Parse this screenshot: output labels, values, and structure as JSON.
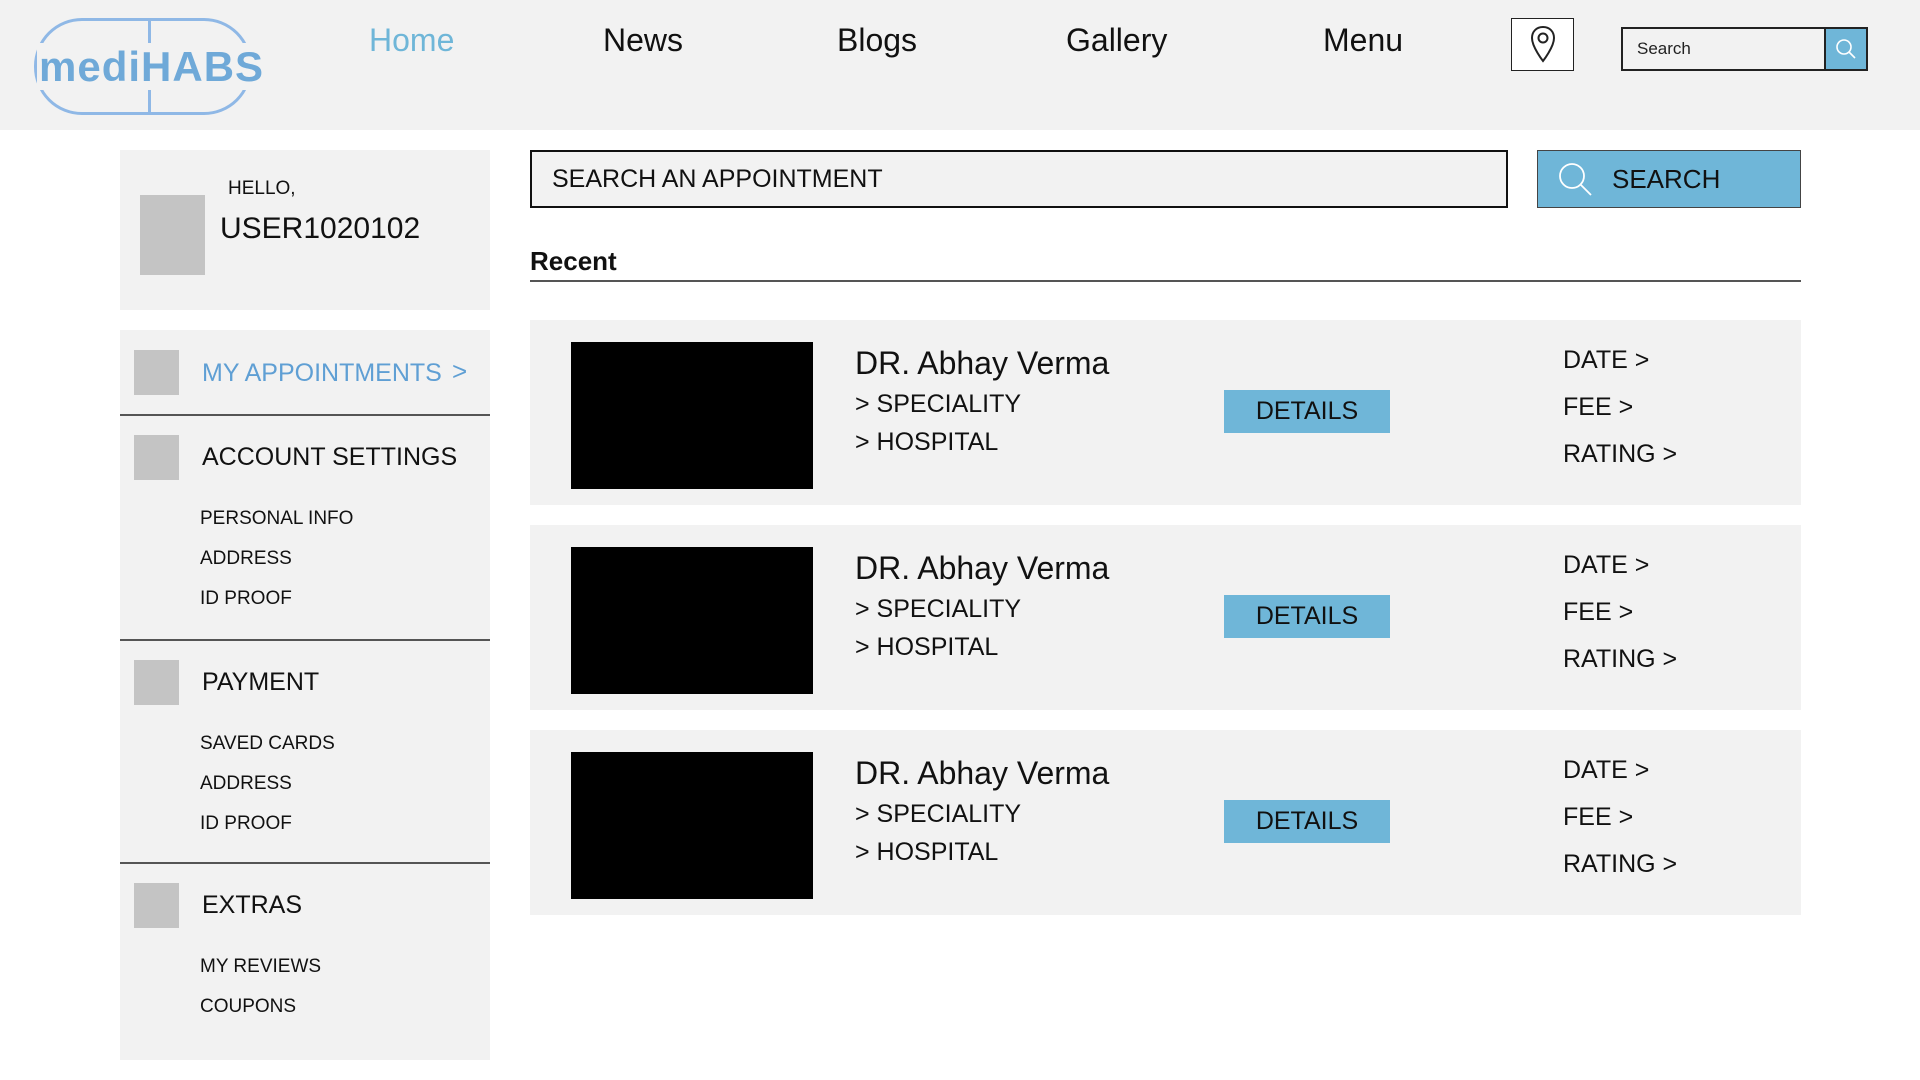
{
  "brand": {
    "logo_text": "mediHABS"
  },
  "nav": {
    "links": [
      {
        "label": "Home",
        "active": true
      },
      {
        "label": "News",
        "active": false
      },
      {
        "label": "Blogs",
        "active": false
      },
      {
        "label": "Gallery",
        "active": false
      },
      {
        "label": "Menu",
        "active": false
      }
    ],
    "location_icon": "map-pin-icon",
    "search_placeholder": "Search"
  },
  "user": {
    "greeting": "HELLO,",
    "username": "USER1020102"
  },
  "sidebar": {
    "sections": [
      {
        "title": "MY APPOINTMENTS",
        "active": true,
        "chevron": ">",
        "items": []
      },
      {
        "title": "ACCOUNT SETTINGS",
        "active": false,
        "items": [
          "PERSONAL INFO",
          "ADDRESS",
          "ID PROOF"
        ]
      },
      {
        "title": "PAYMENT",
        "active": false,
        "items": [
          "SAVED CARDS",
          "ADDRESS",
          "ID PROOF"
        ]
      },
      {
        "title": "EXTRAS",
        "active": false,
        "items": [
          "MY REVIEWS",
          "COUPONS"
        ]
      }
    ]
  },
  "appointment_search": {
    "placeholder": "SEARCH AN APPOINTMENT",
    "button_label": "SEARCH"
  },
  "recent": {
    "heading": "Recent",
    "items": [
      {
        "doctor": "DR. Abhay Verma",
        "speciality": "> SPECIALITY",
        "hospital": "> HOSPITAL",
        "details_label": "DETAILS",
        "date": "DATE >",
        "fee": "FEE >",
        "rating": "RATING >"
      },
      {
        "doctor": "DR. Abhay Verma",
        "speciality": "> SPECIALITY",
        "hospital": "> HOSPITAL",
        "details_label": "DETAILS",
        "date": "DATE >",
        "fee": "FEE >",
        "rating": "RATING >"
      },
      {
        "doctor": "DR. Abhay Verma",
        "speciality": "> SPECIALITY",
        "hospital": "> HOSPITAL",
        "details_label": "DETAILS",
        "date": "DATE >",
        "fee": "FEE >",
        "rating": "RATING >"
      }
    ]
  },
  "colors": {
    "accent": "#6fb6d8",
    "active_link": "#5f9fd4",
    "panel": "#f2f2f2",
    "placeholder": "#c4c4c4"
  }
}
